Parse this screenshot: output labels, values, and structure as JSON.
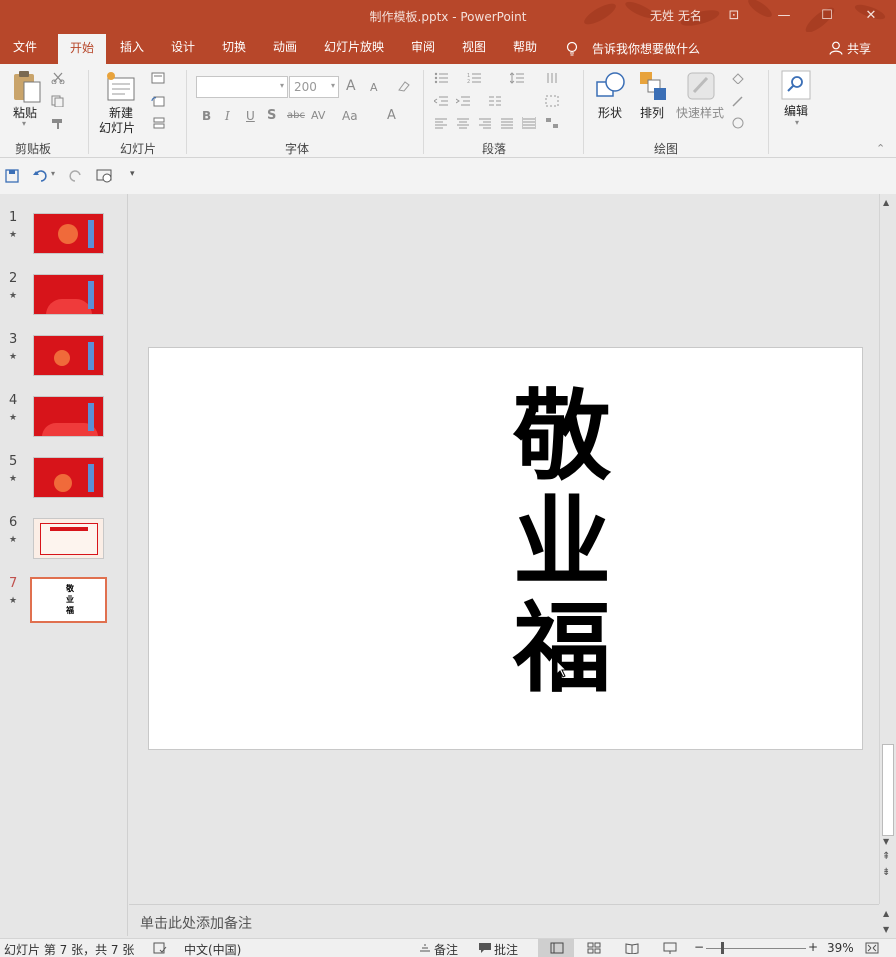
{
  "window": {
    "title": "制作模板.pptx  -  PowerPoint",
    "user": "无姓 无名",
    "controls": {
      "options": "⊡",
      "minimize": "—",
      "maximize": "☐",
      "close": "✕"
    }
  },
  "tabs": [
    "文件",
    "开始",
    "插入",
    "设计",
    "切换",
    "动画",
    "幻灯片放映",
    "审阅",
    "视图",
    "帮助"
  ],
  "tellme": "告诉我你想要做什么",
  "share": "共享",
  "ribbon": {
    "clipboard": {
      "paste": "粘贴",
      "label": "剪贴板"
    },
    "slides": {
      "new_slide_line1": "新建",
      "new_slide_line2": "幻灯片",
      "label": "幻灯片"
    },
    "font": {
      "size": "200",
      "label": "字体",
      "bold": "B",
      "italic": "I",
      "underline": "U",
      "shadow": "S",
      "strike": "abc",
      "spacing": "AV",
      "case": "Aa",
      "color": "A",
      "grow": "A",
      "shrink": "A"
    },
    "paragraph": {
      "label": "段落"
    },
    "drawing": {
      "shapes": "形状",
      "arrange": "排列",
      "quickstyles": "快速样式",
      "label": "绘图"
    },
    "editing": {
      "label": "编辑"
    }
  },
  "slides": [
    {
      "num": "1",
      "star": "★"
    },
    {
      "num": "2",
      "star": "★"
    },
    {
      "num": "3",
      "star": "★"
    },
    {
      "num": "4",
      "star": "★"
    },
    {
      "num": "5",
      "star": "★"
    },
    {
      "num": "6",
      "star": "★"
    },
    {
      "num": "7",
      "star": "★",
      "selected": true,
      "chars": "敬业福"
    }
  ],
  "slide_content": {
    "char1": "敬",
    "char2": "业",
    "char3": "福"
  },
  "notes_placeholder": "单击此处添加备注",
  "status": {
    "slide_info": "幻灯片 第 7 张，共 7 张",
    "language": "中文(中国)",
    "notes": "备注",
    "comments": "批注",
    "zoom": "39%",
    "zoom_minus": "−",
    "zoom_plus": "+"
  },
  "colors": {
    "accent": "#b7472a",
    "slide_red": "#d7141a",
    "selected_border": "#e0704f"
  }
}
